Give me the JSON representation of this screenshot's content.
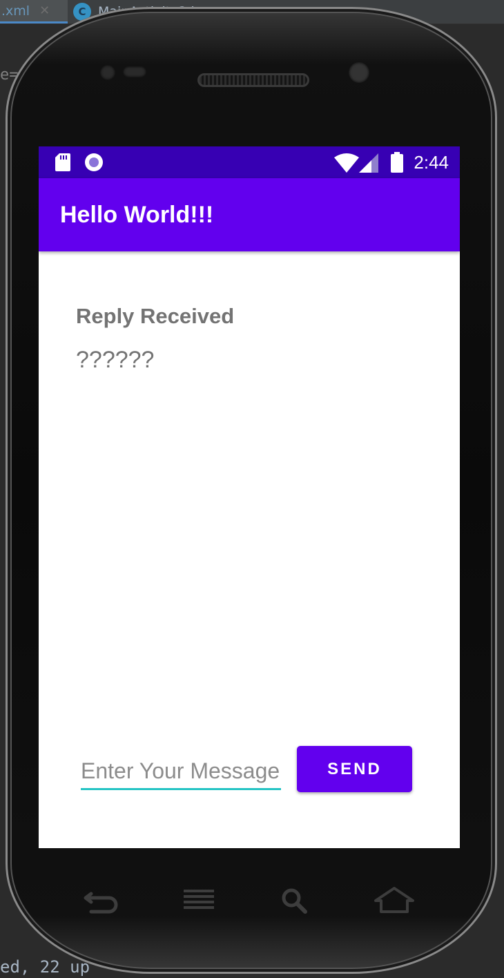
{
  "ide": {
    "tab_active_label": ".xml",
    "tab_active_close": "✕",
    "tab_second_icon_letter": "C",
    "tab_second_label": "MainActivity2.j",
    "tab_second_close": "✕",
    "left_gutter_text": "e=",
    "bottom_console_text": "ed, 22 up"
  },
  "status_bar": {
    "time": "2:44",
    "icons": [
      "sd-card-icon",
      "record-icon",
      "wifi-icon",
      "signal-icon",
      "battery-icon"
    ],
    "color": "#3700b3"
  },
  "app_bar": {
    "title": "Hello World!!!",
    "color": "#6200ee"
  },
  "content": {
    "reply_header": "Reply Received",
    "reply_text": "??????"
  },
  "composer": {
    "input_placeholder": "Enter Your Message",
    "input_value": "",
    "send_label": "SEND",
    "accent_color": "#25c4c4"
  },
  "hardware_nav": [
    "back-icon",
    "menu-icon",
    "search-icon",
    "home-icon"
  ]
}
